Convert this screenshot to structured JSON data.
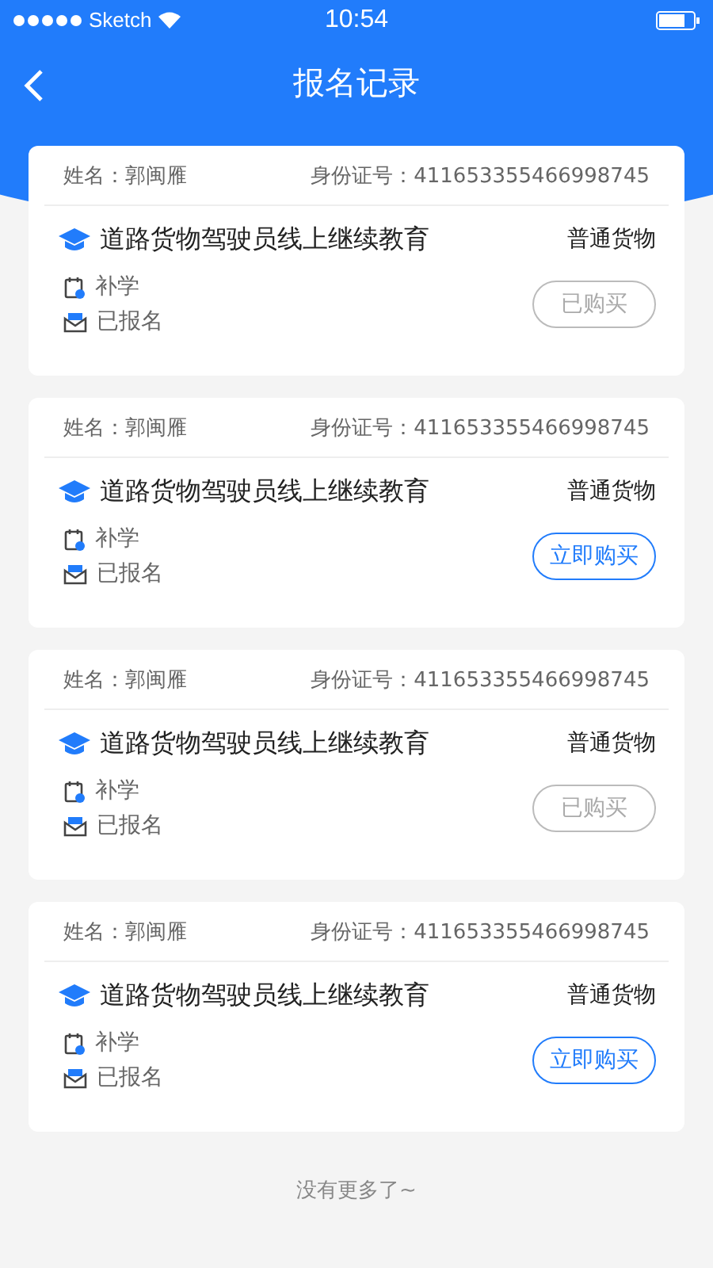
{
  "status_bar": {
    "carrier": "Sketch",
    "time": "10:54"
  },
  "nav": {
    "title": "报名记录"
  },
  "records": [
    {
      "name_label": "姓名：",
      "name": "郭闽雁",
      "id_label": "身份证号：",
      "id_number": "411653355466998745",
      "course": "道路货物驾驶员线上继续教育",
      "category": "普通货物",
      "study_type": "补学",
      "enroll_status": "已报名",
      "button": "已购买",
      "purchased": true
    },
    {
      "name_label": "姓名：",
      "name": "郭闽雁",
      "id_label": "身份证号：",
      "id_number": "411653355466998745",
      "course": "道路货物驾驶员线上继续教育",
      "category": "普通货物",
      "study_type": "补学",
      "enroll_status": "已报名",
      "button": "立即购买",
      "purchased": false
    },
    {
      "name_label": "姓名：",
      "name": "郭闽雁",
      "id_label": "身份证号：",
      "id_number": "411653355466998745",
      "course": "道路货物驾驶员线上继续教育",
      "category": "普通货物",
      "study_type": "补学",
      "enroll_status": "已报名",
      "button": "已购买",
      "purchased": true
    },
    {
      "name_label": "姓名：",
      "name": "郭闽雁",
      "id_label": "身份证号：",
      "id_number": "411653355466998745",
      "course": "道路货物驾驶员线上继续教育",
      "category": "普通货物",
      "study_type": "补学",
      "enroll_status": "已报名",
      "button": "立即购买",
      "purchased": false
    }
  ],
  "footer": "没有更多了~"
}
